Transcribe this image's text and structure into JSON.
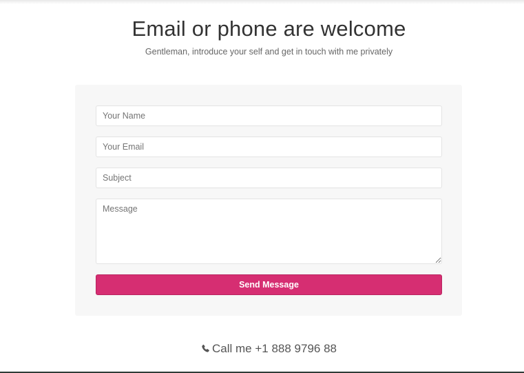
{
  "header": {
    "title": "Email or phone are welcome",
    "subtitle": "Gentleman, introduce your self and get in touch with me privately"
  },
  "form": {
    "name_placeholder": "Your Name",
    "email_placeholder": "Your Email",
    "subject_placeholder": "Subject",
    "message_placeholder": "Message",
    "send_label": "Send Message"
  },
  "contact": {
    "call_text": "Call me +1 888 9796 88",
    "icon": "phone-icon"
  },
  "colors": {
    "accent": "#d62e72",
    "card_background": "#f7f7f7",
    "text": "#333333"
  }
}
